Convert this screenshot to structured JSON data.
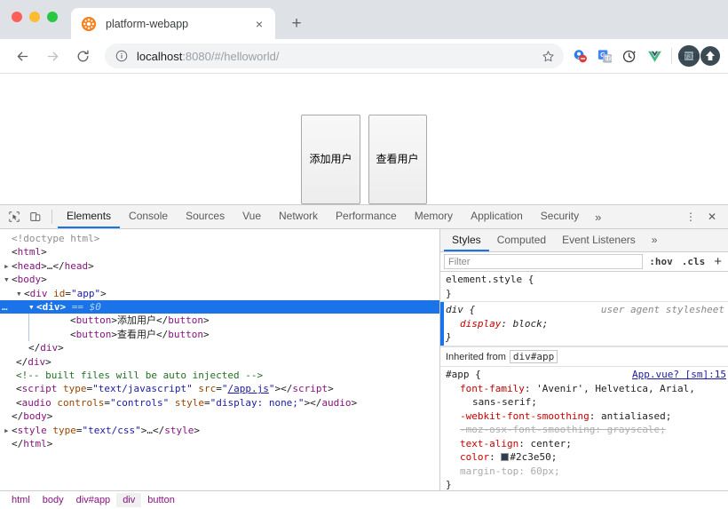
{
  "browser": {
    "tab": {
      "title": "platform-webapp",
      "favicon": "orange-sunburst-favicon",
      "close": "×"
    },
    "new_tab_label": "+",
    "nav": {
      "back": "←",
      "forward": "→",
      "reload": "↻"
    },
    "omnibox": {
      "info_icon": "info-circle-icon",
      "host": "localhost",
      "rest": ":8080/#/helloworld/",
      "star_icon": "star-icon"
    },
    "extensions": [
      {
        "name": "adblock-extension-icon"
      },
      {
        "name": "google-translate-extension-icon"
      },
      {
        "name": "history-sync-extension-icon"
      },
      {
        "name": "vue-devtools-extension-icon"
      }
    ],
    "profile_avatar": "profile-avatar",
    "update_button": "update-arrow-icon"
  },
  "page": {
    "buttons": [
      {
        "label": "添加用户"
      },
      {
        "label": "查看用户"
      }
    ]
  },
  "devtools": {
    "inspect_icon": "inspect-element-icon",
    "device_icon": "toggle-device-toolbar-icon",
    "tabs": [
      {
        "label": "Elements",
        "active": true
      },
      {
        "label": "Console",
        "active": false
      },
      {
        "label": "Sources",
        "active": false
      },
      {
        "label": "Vue",
        "active": false
      },
      {
        "label": "Network",
        "active": false
      },
      {
        "label": "Performance",
        "active": false
      },
      {
        "label": "Memory",
        "active": false
      },
      {
        "label": "Application",
        "active": false
      },
      {
        "label": "Security",
        "active": false
      }
    ],
    "more_tabs": "»",
    "menu_icon": "⋮",
    "close_icon": "✕",
    "dom": {
      "lines": [
        {
          "text": "<!doctype html>"
        },
        {
          "text": "<html>"
        },
        {
          "text": "<head>…</head>"
        },
        {
          "text": "<body>"
        },
        {
          "text": "<div id=\"app\">"
        },
        {
          "text": "<div> == $0",
          "selected": true
        },
        {
          "text": "<button>添加用户</button>"
        },
        {
          "text": "<button>查看用户</button>"
        },
        {
          "text": "</div>"
        },
        {
          "text": "</div>"
        },
        {
          "text": "<!-- built files will be auto injected -->"
        },
        {
          "text": "<script type=\"text/javascript\" src=\"/app.js\"></script>"
        },
        {
          "text": "<audio controls=\"controls\" style=\"display: none;\"></audio>"
        },
        {
          "text": "</body>"
        },
        {
          "text": "<style type=\"text/css\">…</style>"
        },
        {
          "text": "</html>"
        }
      ],
      "script_src": "/app.js",
      "dollar_marker": "$0"
    },
    "breadcrumbs": [
      {
        "label": "html",
        "active": false
      },
      {
        "label": "body",
        "active": false
      },
      {
        "label": "div#app",
        "active": false
      },
      {
        "label": "div",
        "active": true
      },
      {
        "label": "button",
        "active": false
      }
    ],
    "styles": {
      "tabs": [
        {
          "label": "Styles",
          "active": true
        },
        {
          "label": "Computed",
          "active": false
        },
        {
          "label": "Event Listeners",
          "active": false
        }
      ],
      "more_tabs": "»",
      "filter_placeholder": "Filter",
      "hov_label": ":hov",
      "cls_label": ".cls",
      "plus_label": "+",
      "rules": [
        {
          "selector": "element.style {",
          "origin": "",
          "close": "}",
          "declarations": []
        },
        {
          "selector": "div {",
          "origin": "user agent stylesheet",
          "close": "}",
          "declarations": [
            {
              "prop": "display",
              "value": "block;",
              "state": "normal"
            }
          ]
        }
      ],
      "inherited_label": "Inherited from",
      "inherited_chip": "div#app",
      "app_rule": {
        "selector": "#app {",
        "source": "App.vue? [sm]:15",
        "close": "}",
        "declarations": [
          {
            "prop": "font-family",
            "value": "'Avenir', Helvetica, Arial,",
            "value2": "sans-serif;",
            "state": "normal"
          },
          {
            "prop": "-webkit-font-smoothing",
            "value": "antialiased;",
            "state": "normal"
          },
          {
            "prop": "-moz-osx-font-smoothing",
            "value": "grayscale;",
            "state": "disabled"
          },
          {
            "prop": "text-align",
            "value": "center;",
            "state": "normal"
          },
          {
            "prop": "color",
            "value": "#2c3e50;",
            "state": "normal",
            "swatch": "#2c3e50"
          },
          {
            "prop": "margin-top",
            "value": "60px;",
            "state": "dim"
          }
        ]
      }
    }
  }
}
